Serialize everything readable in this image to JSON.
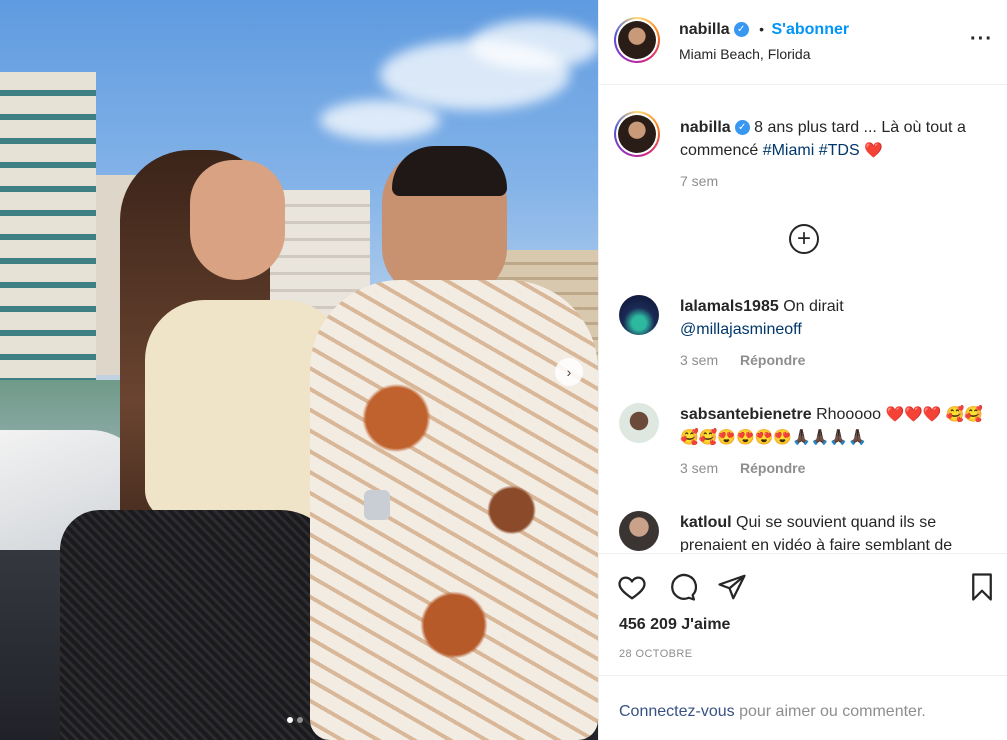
{
  "header": {
    "username": "nabilla",
    "separator": "•",
    "follow_label": "S'abonner",
    "location": "Miami Beach, Florida",
    "more_icon": "more-horizontal-icon"
  },
  "caption": {
    "username": "nabilla",
    "text": "8 ans plus tard ... Là où tout a commencé",
    "hashtags": "#Miami #TDS",
    "emoji": "❤️",
    "time": "7 sem"
  },
  "load_more_icon": "plus-circle-icon",
  "comments": [
    {
      "username": "lalamals1985",
      "text": "On dirait",
      "mention": "@millajasmineoff",
      "time": "3 sem",
      "reply_label": "Répondre"
    },
    {
      "username": "sabsantebienetre",
      "text": "Rhooooo",
      "emojis": "❤️❤️❤️ 🥰🥰🥰🥰😍😍😍😍🙏🏿🙏🏿🙏🏿🙏🏿",
      "time": "3 sem",
      "reply_label": "Répondre"
    },
    {
      "username": "katloul",
      "text": "Qui se souvient quand ils se prenaient en vidéo à faire semblant de"
    }
  ],
  "actions": {
    "like_icon": "heart-icon",
    "comment_icon": "comment-icon",
    "share_icon": "paper-plane-icon",
    "save_icon": "bookmark-icon"
  },
  "likes": "456 209 J'aime",
  "date": "28 OCTOBRE",
  "login": {
    "link": "Connectez-vous",
    "text": "pour aimer ou commenter."
  },
  "carousel": {
    "count": 2,
    "active": 1
  },
  "colors": {
    "accent": "#0095f6",
    "verified": "#3897f0",
    "heart": "#ed4956"
  }
}
